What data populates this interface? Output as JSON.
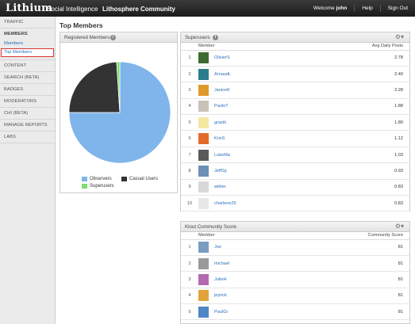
{
  "header": {
    "logo": "Lithium",
    "app_title": "Social Intelligence",
    "community": "Lithosphere Community",
    "welcome_prefix": "Welcome ",
    "welcome_user": "john",
    "help": "Help",
    "sign_out": "Sign Out"
  },
  "sidebar": {
    "traffic": "TRAFFIC",
    "members": "MEMBERS",
    "members_sub": "Members",
    "top_members": "Top Members",
    "content": "CONTENT",
    "search": "SEARCH (BETA)",
    "badges": "BADGES",
    "moderators": "MODERATORS",
    "chi": "CHI (BETA)",
    "manage_reports": "MANAGE REPORTS",
    "labs": "LABS"
  },
  "page_title": "Top Members",
  "registered_panel": {
    "title": "Registered Members",
    "legend": {
      "observers": "Observers",
      "casual": "Casual Users",
      "superusers": "Superusers"
    }
  },
  "chart_data": {
    "type": "pie",
    "slices": [
      {
        "name": "Observers",
        "value": 75,
        "color": "#7fb5ea"
      },
      {
        "name": "Casual Users",
        "value": 24,
        "color": "#333333"
      },
      {
        "name": "Superusers",
        "value": 1,
        "color": "#7ddd6f"
      }
    ],
    "legend_position": "bottom"
  },
  "superusers_panel": {
    "title": "Superusers",
    "col_member": "Member",
    "col_value": "Avg Daily Posts",
    "rows": [
      {
        "idx": "1",
        "name": "OlivierS",
        "value": "2.78",
        "avatar": "#3e6b2f"
      },
      {
        "idx": "2",
        "name": "ArnaudL",
        "value": "2.40",
        "avatar": "#2a7d8c"
      },
      {
        "idx": "3",
        "name": "JaniceK",
        "value": "2.28",
        "avatar": "#e09a2b"
      },
      {
        "idx": "4",
        "name": "PaoloT",
        "value": "1.88",
        "avatar": "#c8c2b8"
      },
      {
        "idx": "5",
        "name": "graziti",
        "value": "1.80",
        "avatar": "#f4e7a0"
      },
      {
        "idx": "6",
        "name": "KrisS",
        "value": "1.12",
        "avatar": "#e36b2a"
      },
      {
        "idx": "7",
        "name": "LukeMa",
        "value": "1.03",
        "avatar": "#5a5a5a"
      },
      {
        "idx": "8",
        "name": "JeffSp",
        "value": "0.93",
        "avatar": "#6c8fb5"
      },
      {
        "idx": "9",
        "name": "wittier",
        "value": "0.83",
        "avatar": "#d8d8d8"
      },
      {
        "idx": "10",
        "name": "charlene25",
        "value": "0.83",
        "avatar": "#e8e8e8"
      }
    ]
  },
  "klout_panel": {
    "title": "Klout Community Score",
    "col_member": "Member",
    "col_value": "Community Score",
    "rows": [
      {
        "idx": "1",
        "name": "Joe",
        "value": "81",
        "avatar": "#7a9cc0"
      },
      {
        "idx": "2",
        "name": "michael",
        "value": "81",
        "avatar": "#9a9a9a"
      },
      {
        "idx": "3",
        "name": "JulieH",
        "value": "81",
        "avatar": "#b26ab0"
      },
      {
        "idx": "4",
        "name": "jeyrick",
        "value": "81",
        "avatar": "#e0a43a"
      },
      {
        "idx": "5",
        "name": "PaulGi",
        "value": "81",
        "avatar": "#4e86c6"
      }
    ]
  }
}
